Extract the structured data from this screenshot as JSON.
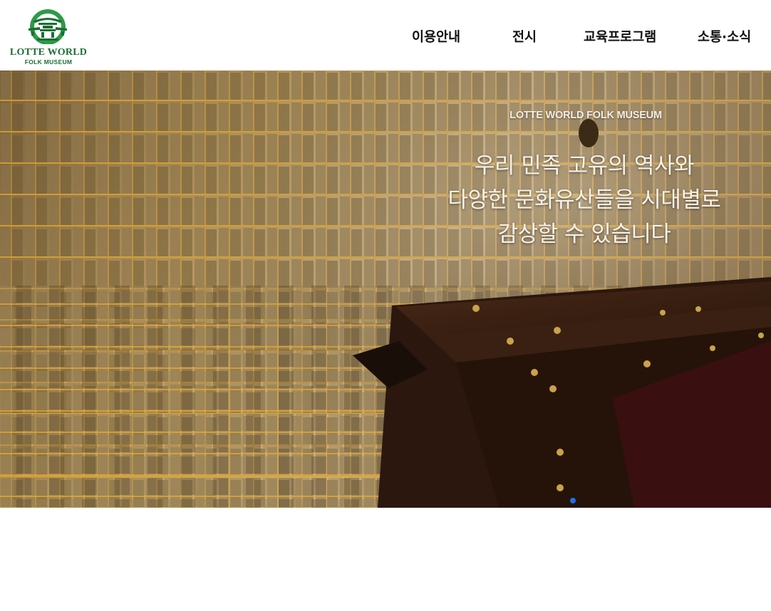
{
  "logo": {
    "title": "LOTTE WORLD",
    "subtitle": "FOLK MUSEUM",
    "emblem_icon": "palace-gate-emblem",
    "brand_color": "#1a6e34",
    "accent_color": "#2e9b47"
  },
  "nav": {
    "items": [
      {
        "label": "이용안내"
      },
      {
        "label": "전시"
      },
      {
        "label": "교육프로그램"
      },
      {
        "label": "소통·소식"
      }
    ]
  },
  "hero": {
    "eyebrow": "LOTTE WORLD FOLK MUSEUM",
    "lines": [
      "우리 민족 고유의 역사와",
      "다양한 문화유산들을 시대별로",
      "감상할 수 있습니다"
    ],
    "slide_count": 1,
    "active_slide": 1,
    "indicator_color": "#1a73e8"
  }
}
